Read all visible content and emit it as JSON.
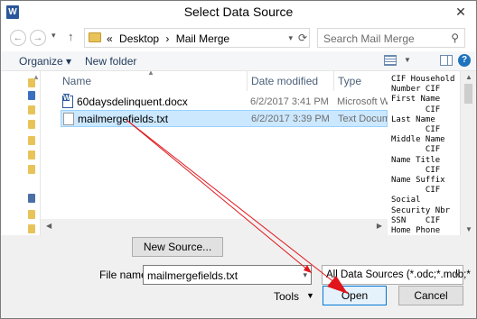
{
  "window": {
    "title": "Select Data Source",
    "app_icon": "W"
  },
  "nav": {
    "back": "←",
    "forward": "→",
    "up": "↑",
    "path": [
      "Desktop",
      "Mail Merge"
    ],
    "path_prefix": "«",
    "sep": "›"
  },
  "search": {
    "placeholder": "Search Mail Merge"
  },
  "toolbar": {
    "organize": "Organize ▾",
    "new_folder": "New folder",
    "help": "?"
  },
  "columns": {
    "name": "Name",
    "date": "Date modified",
    "type": "Type"
  },
  "files": [
    {
      "name": "60daysdelinquent.docx",
      "date": "6/2/2017 3:41 PM",
      "type": "Microsoft W"
    },
    {
      "name": "mailmergefields.txt",
      "date": "6/2/2017 3:39 PM",
      "type": "Text Docum"
    }
  ],
  "preview": {
    "text": "CIF Household\nNumber CIF\nFirst Name\n       CIF\nLast Name\n       CIF\nMiddle Name\n       CIF\nName Title\n       CIF\nName Suffix\n       CIF\nSocial\nSecurity Nbr\nSSN    CIF\nHome Phone"
  },
  "footer": {
    "new_source": "New Source...",
    "file_name_label": "File name:",
    "file_name_value": "mailmergefields.txt",
    "filter_value": "All Data Sources (*.odc;*.mdb;*",
    "tools": "Tools",
    "open": "Open",
    "cancel": "Cancel"
  },
  "colors": {
    "annotation_arrow": "#e0161b",
    "selection": "#cce8ff",
    "accent": "#0078d7"
  }
}
